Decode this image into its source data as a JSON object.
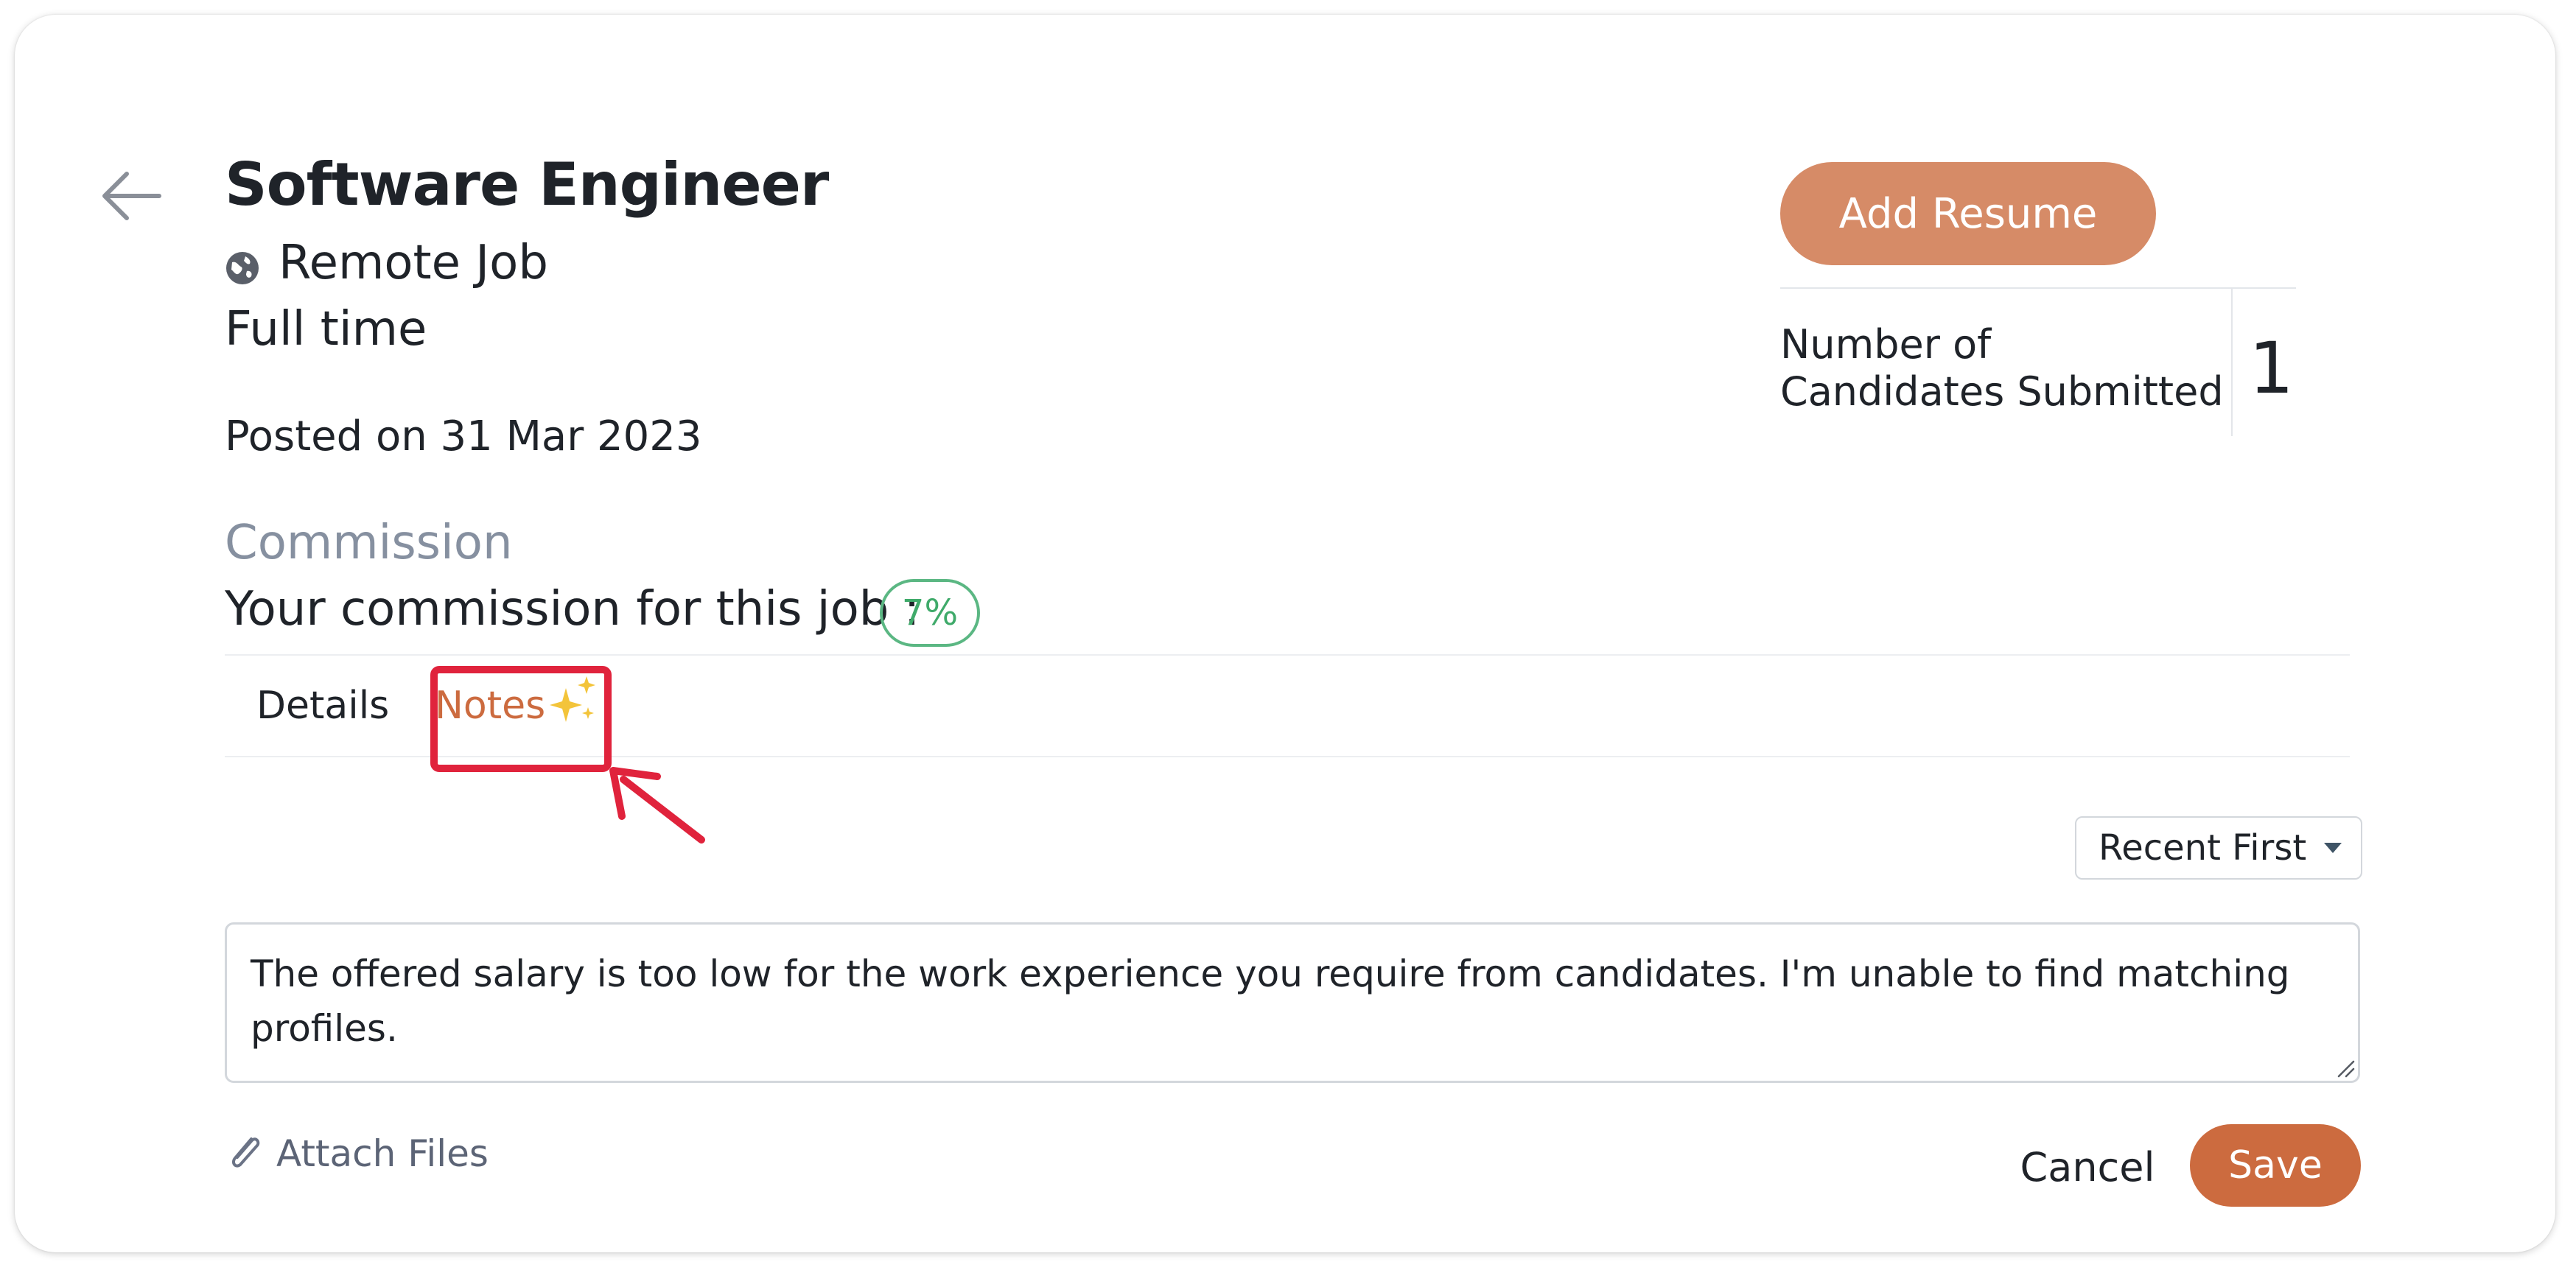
{
  "job": {
    "title": "Software Engineer",
    "location": "Remote Job",
    "type": "Full time",
    "posted": "Posted on 31 Mar 2023"
  },
  "commission": {
    "heading": "Commission",
    "label": "Your commission for this job :",
    "value": "7%"
  },
  "actions": {
    "add_resume": "Add Resume"
  },
  "stats": {
    "label_line1": "Number of",
    "label_line2": "Candidates Submitted",
    "value": "1"
  },
  "tabs": [
    {
      "label": "Details",
      "active": false
    },
    {
      "label": "Notes",
      "active": true
    }
  ],
  "sort": {
    "selected": "Recent First"
  },
  "note": {
    "text": "The offered salary is too low for the work experience you require from candidates. I'm unable to find matching profiles."
  },
  "footer": {
    "attach": "Attach Files",
    "cancel": "Cancel",
    "save": "Save"
  },
  "colors": {
    "accent": "#cc6b3f",
    "add_resume": "#d68b67",
    "commission_badge": "#5bb783",
    "highlight": "#e0233c"
  },
  "icons": {
    "back": "arrow-left-icon",
    "location": "globe-icon",
    "notes_tab": "sparkle-icon",
    "sort": "caret-down-icon",
    "attach": "paperclip-icon"
  }
}
